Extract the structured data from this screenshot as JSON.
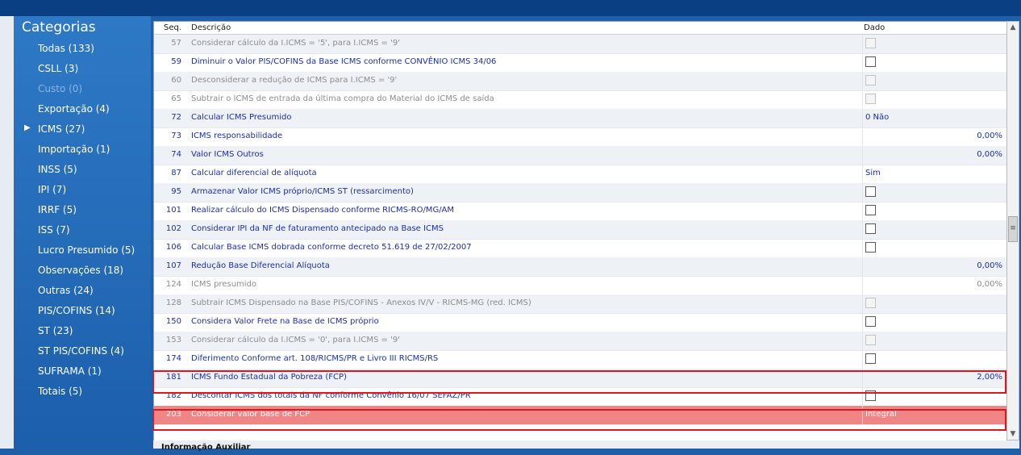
{
  "sidebar": {
    "title": "Categorias",
    "categories": [
      {
        "label": "Todas (133)"
      },
      {
        "label": "CSLL (3)"
      },
      {
        "label": "Custo (0)"
      },
      {
        "label": "Exportação (4)"
      },
      {
        "label": "ICMS (27)"
      },
      {
        "label": "Importação (1)"
      },
      {
        "label": "INSS (5)"
      },
      {
        "label": "IPI (7)"
      },
      {
        "label": "IRRF (5)"
      },
      {
        "label": "ISS (7)"
      },
      {
        "label": "Lucro Presumido (5)"
      },
      {
        "label": "Observações (18)"
      },
      {
        "label": "Outras (24)"
      },
      {
        "label": "PIS/COFINS (14)"
      },
      {
        "label": "ST (23)"
      },
      {
        "label": "ST PIS/COFINS (4)"
      },
      {
        "label": "SUFRAMA (1)"
      },
      {
        "label": "Totais (5)"
      }
    ],
    "selected": "ICMS (27)",
    "disabled": "Custo (0)"
  },
  "grid": {
    "headers": {
      "seq": "Seq.",
      "desc": "Descrição",
      "dado": "Dado"
    },
    "rows": [
      {
        "seq": "57",
        "desc": "Considerar cálculo da I.ICMS = '5', para I.ICMS = '9'",
        "dado": "",
        "type": "checkbox",
        "state": "inactive"
      },
      {
        "seq": "59",
        "desc": "Diminuir o Valor PIS/COFINS da Base ICMS conforme CONVÊNIO ICMS 34/06",
        "dado": "",
        "type": "checkbox",
        "state": "active"
      },
      {
        "seq": "60",
        "desc": "Desconsiderar a redução de ICMS para I.ICMS = '9'",
        "dado": "",
        "type": "checkbox",
        "state": "inactive"
      },
      {
        "seq": "65",
        "desc": "Subtrair o ICMS de entrada da última compra do Material do ICMS de saída",
        "dado": "",
        "type": "checkbox",
        "state": "inactive"
      },
      {
        "seq": "72",
        "desc": "Calcular ICMS Presumido",
        "dado": "0 Não",
        "type": "text",
        "state": "active"
      },
      {
        "seq": "73",
        "desc": "ICMS responsabilidade",
        "dado": "0,00%",
        "type": "number",
        "state": "active"
      },
      {
        "seq": "74",
        "desc": "Valor ICMS Outros",
        "dado": "0,00%",
        "type": "number",
        "state": "active"
      },
      {
        "seq": "87",
        "desc": "Calcular diferencial de alíquota",
        "dado": "Sim",
        "type": "text",
        "state": "active"
      },
      {
        "seq": "95",
        "desc": "Armazenar Valor ICMS próprio/ICMS ST (ressarcimento)",
        "dado": "",
        "type": "checkbox",
        "state": "active"
      },
      {
        "seq": "101",
        "desc": "Realizar cálculo do ICMS Dispensado conforme RICMS-RO/MG/AM",
        "dado": "",
        "type": "checkbox",
        "state": "active"
      },
      {
        "seq": "102",
        "desc": "Considerar IPI da NF de faturamento antecipado na Base ICMS",
        "dado": "",
        "type": "checkbox",
        "state": "active"
      },
      {
        "seq": "106",
        "desc": "Calcular Base ICMS dobrada conforme decreto 51.619 de 27/02/2007",
        "dado": "",
        "type": "checkbox",
        "state": "active"
      },
      {
        "seq": "107",
        "desc": "Redução Base Diferencial Alíquota",
        "dado": "0,00%",
        "type": "number",
        "state": "active"
      },
      {
        "seq": "124",
        "desc": "ICMS presumido",
        "dado": "0,00%",
        "type": "number",
        "state": "inactive"
      },
      {
        "seq": "128",
        "desc": "Subtrair ICMS Dispensado na Base PIS/COFINS - Anexos IV/V - RICMS-MG (red. ICMS)",
        "dado": "",
        "type": "checkbox",
        "state": "inactive"
      },
      {
        "seq": "150",
        "desc": "Considera Valor Frete na Base de ICMS próprio",
        "dado": "",
        "type": "checkbox",
        "state": "active"
      },
      {
        "seq": "153",
        "desc": "Considerar cálculo da I.ICMS = '0', para I.ICMS = '9'",
        "dado": "",
        "type": "checkbox",
        "state": "inactive"
      },
      {
        "seq": "174",
        "desc": "Diferimento Conforme art. 108/RICMS/PR e Livro III RICMS/RS",
        "dado": "",
        "type": "checkbox",
        "state": "active"
      },
      {
        "seq": "181",
        "desc": "ICMS Fundo Estadual da Pobreza (FCP)",
        "dado": "2,00%",
        "type": "number",
        "state": "active",
        "highlight": true
      },
      {
        "seq": "182",
        "desc": "Descontar ICMS dos totais da NF conforme Convênio 16/07 SEFAZ/PR",
        "dado": "",
        "type": "checkbox",
        "state": "active"
      },
      {
        "seq": "203",
        "desc": "Considerar valor base de FCP",
        "dado": "Integral",
        "type": "text",
        "state": "selected",
        "highlight": true
      }
    ]
  },
  "footer": {
    "label": "Informação Auxiliar"
  },
  "colors": {
    "sidebar": "#1f5fa8",
    "titlebar": "#0b3f84",
    "highlight_border": "#e0161e",
    "selected_row": "#f08585",
    "active_text": "#1d2fa5"
  }
}
